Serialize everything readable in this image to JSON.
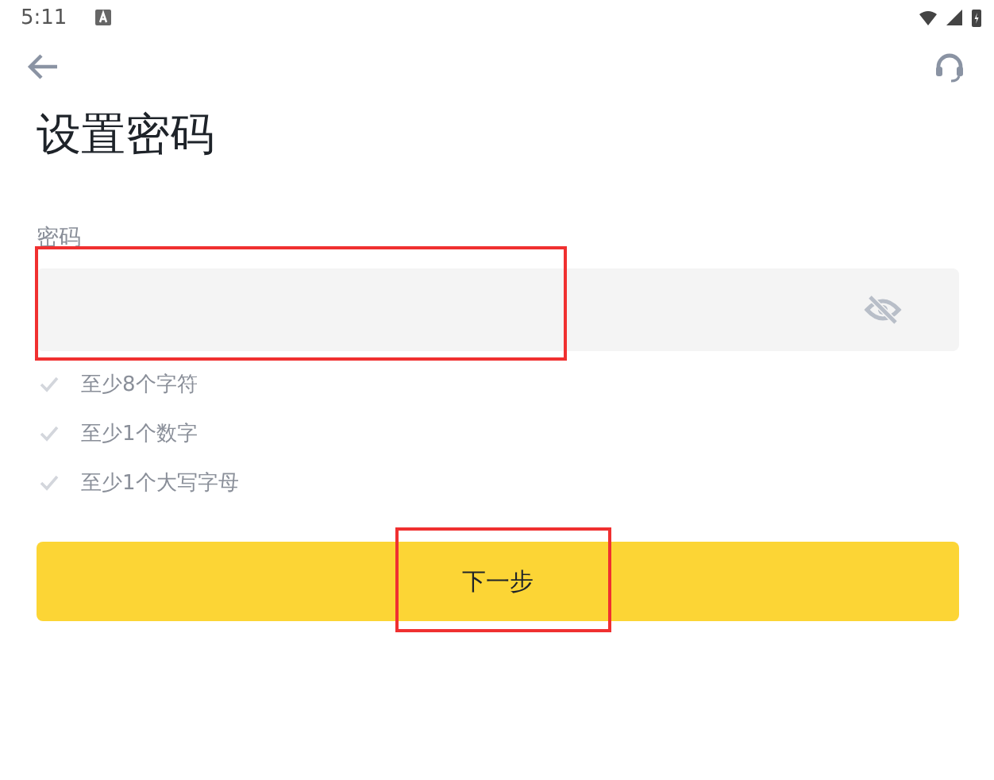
{
  "status_bar": {
    "time": "5:11"
  },
  "title": "设置密码",
  "password_field": {
    "label": "密码"
  },
  "rules": [
    {
      "text": "至少8个字符",
      "met": false
    },
    {
      "text": "至少1个数字",
      "met": false
    },
    {
      "text": "至少1个大写字母",
      "met": false
    }
  ],
  "next_button": {
    "label": "下一步"
  }
}
